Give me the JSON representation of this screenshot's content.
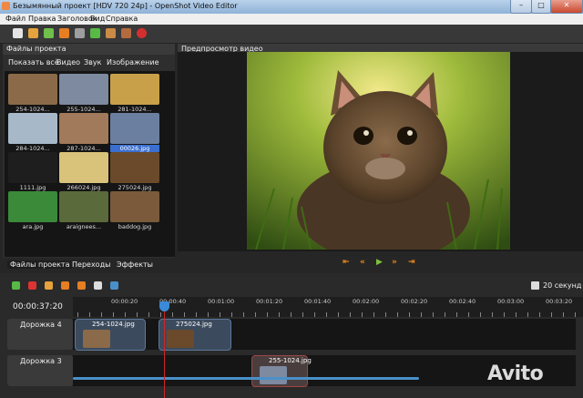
{
  "window": {
    "title": "Безымянный проект [HDV 720 24p] - OpenShot Video Editor",
    "minimize": "–",
    "maximize": "□",
    "close": "✕"
  },
  "menu": [
    "Файл",
    "Правка",
    "Заголовок",
    "Вид",
    "Справка"
  ],
  "toolbar": {
    "icons": [
      "new-project-icon",
      "open-project-icon",
      "save-project-icon",
      "undo-icon",
      "redo-icon",
      "add-file-icon",
      "import-icon",
      "export-icon",
      "record-icon"
    ],
    "colors": [
      "#e4e4e4",
      "#e6a23c",
      "#6fbf4a",
      "#e67e22",
      "#9e9e9e",
      "#58b947",
      "#c98b45",
      "#b36a3e",
      "#d32f2f"
    ]
  },
  "project_files": {
    "title": "Файлы проекта",
    "filters": [
      "Показать всё",
      "Видео",
      "Звук",
      "Изображение"
    ],
    "items": [
      {
        "label": "254-1024...",
        "color": "#8a6a48",
        "selected": false
      },
      {
        "label": "255-1024...",
        "color": "#7d8aa0",
        "selected": false
      },
      {
        "label": "281-1024...",
        "color": "#c9a04a",
        "selected": false
      },
      {
        "label": "284-1024...",
        "color": "#a7b8c8",
        "selected": false
      },
      {
        "label": "287-1024...",
        "color": "#a07a5a",
        "selected": false
      },
      {
        "label": "00026.jpg",
        "color": "#6b7fa0",
        "selected": true
      },
      {
        "label": "1111.jpg",
        "color": "#1e1e1e",
        "selected": false
      },
      {
        "label": "266024.jpg",
        "color": "#d9c27a",
        "selected": false
      },
      {
        "label": "275024.jpg",
        "color": "#6a4a2a",
        "selected": false
      },
      {
        "label": "ara.jpg",
        "color": "#3a8a3a",
        "selected": false
      },
      {
        "label": "araignees...",
        "color": "#5a6a3a",
        "selected": false
      },
      {
        "label": "baddog.jpg",
        "color": "#7a5a3a",
        "selected": false
      }
    ],
    "tabs": [
      "Файлы проекта",
      "Переходы",
      "Эффекты"
    ]
  },
  "preview": {
    "title": "Предпросмотр видео"
  },
  "transport": [
    "⇤",
    "«",
    "▶",
    "»",
    "⇥"
  ],
  "timeline": {
    "timecode": "00:00:37:20",
    "zoom_label": "20 секунд",
    "ruler": [
      "00:00:20",
      "00:00:40",
      "00:01:00",
      "00:01:20",
      "00:01:40",
      "00:02:00",
      "00:02:20",
      "00:02:40",
      "00:03:00",
      "00:03:20"
    ],
    "tracks": [
      {
        "name": "Дорожка 4",
        "clips": [
          "254-1024.jpg",
          "275024.jpg"
        ]
      },
      {
        "name": "Дорожка 3",
        "clips": [
          "255-1024.jpg"
        ]
      }
    ]
  },
  "watermark": "Avito"
}
